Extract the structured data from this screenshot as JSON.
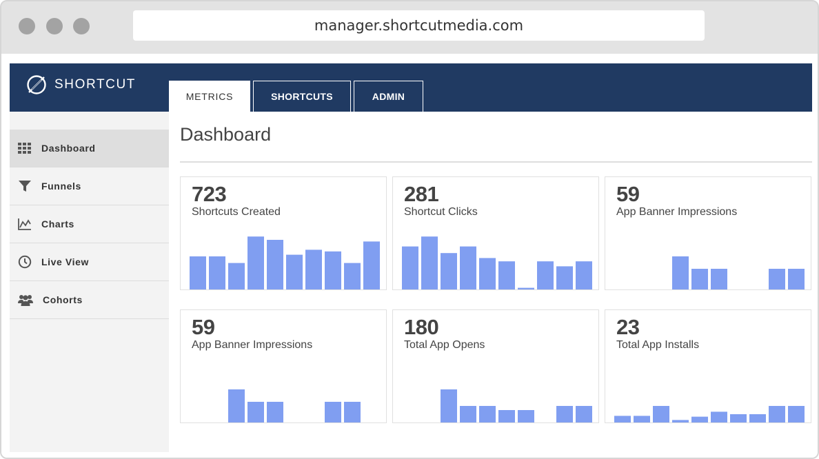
{
  "browser": {
    "url": "manager.shortcutmedia.com"
  },
  "brand": {
    "name": "SHORTCUT",
    "icon": "shortcut-logo-icon"
  },
  "tabs": [
    {
      "label": "METRICS",
      "active": true
    },
    {
      "label": "SHORTCUTS",
      "active": false
    },
    {
      "label": "ADMIN",
      "active": false
    }
  ],
  "sidebar": {
    "items": [
      {
        "label": "Dashboard",
        "icon": "grid-icon",
        "active": true
      },
      {
        "label": "Funnels",
        "icon": "funnel-icon",
        "active": false
      },
      {
        "label": "Charts",
        "icon": "line-chart-icon",
        "active": false
      },
      {
        "label": "Live View",
        "icon": "clock-icon",
        "active": false
      },
      {
        "label": "Cohorts",
        "icon": "users-icon",
        "active": false
      }
    ]
  },
  "main": {
    "title": "Dashboard"
  },
  "colors": {
    "nav": "#203a62",
    "bar": "#809ef1",
    "sidebar": "#f3f3f3"
  },
  "cards": [
    {
      "value": "723",
      "label": "Shortcuts Created"
    },
    {
      "value": "281",
      "label": "Shortcut Clicks"
    },
    {
      "value": "59",
      "label": "App Banner Impressions"
    },
    {
      "value": "59",
      "label": "App Banner Impressions"
    },
    {
      "value": "180",
      "label": "Total App Opens"
    },
    {
      "value": "23",
      "label": "Total App Installs"
    }
  ],
  "chart_data": [
    {
      "type": "bar",
      "values": [
        2,
        2,
        1.6,
        3.2,
        3,
        2.1,
        2.4,
        2.3,
        1.6,
        2.9
      ]
    },
    {
      "type": "bar",
      "values": [
        2.6,
        3.2,
        2.2,
        2.6,
        1.9,
        1.7,
        0.1,
        1.7,
        1.4,
        1.7
      ]
    },
    {
      "type": "bar",
      "values": [
        0,
        0,
        0,
        2,
        1.25,
        1.25,
        0,
        0,
        1.25,
        1.25
      ]
    },
    {
      "type": "bar",
      "values": [
        0,
        0,
        2,
        1.25,
        1.25,
        0,
        0,
        1.25,
        1.25,
        0
      ]
    },
    {
      "type": "bar",
      "values": [
        0,
        0,
        2,
        1,
        1,
        0.75,
        0.75,
        0,
        1,
        1
      ]
    },
    {
      "type": "bar",
      "values": [
        0.4,
        0.4,
        1,
        0.15,
        0.35,
        0.65,
        0.5,
        0.5,
        1,
        1
      ]
    }
  ]
}
